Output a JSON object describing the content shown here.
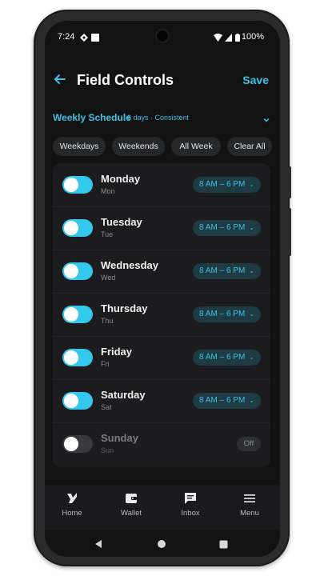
{
  "status_bar": {
    "time": "7:24",
    "battery": "100%"
  },
  "app_bar": {
    "title": "Field Controls",
    "save_label": "Save",
    "back_icon": "arrow-left-icon"
  },
  "schedule": {
    "label": "Weekly Schedule",
    "summary": "6 days · Consistent"
  },
  "chips": [
    "Weekdays",
    "Weekends",
    "All Week",
    "Clear All"
  ],
  "days": [
    {
      "name": "Monday",
      "short": "Mon",
      "enabled": true,
      "hours": "8 AM – 6 PM"
    },
    {
      "name": "Tuesday",
      "short": "Tue",
      "enabled": true,
      "hours": "8 AM – 6 PM"
    },
    {
      "name": "Wednesday",
      "short": "Wed",
      "enabled": true,
      "hours": "8 AM – 6 PM"
    },
    {
      "name": "Thursday",
      "short": "Thu",
      "enabled": true,
      "hours": "8 AM – 6 PM"
    },
    {
      "name": "Friday",
      "short": "Fri",
      "enabled": true,
      "hours": "8 AM – 6 PM"
    },
    {
      "name": "Saturday",
      "short": "Sat",
      "enabled": true,
      "hours": "8 AM – 6 PM"
    },
    {
      "name": "Sunday",
      "short": "Sun",
      "enabled": false,
      "hours": "Off"
    }
  ],
  "bottom_nav": [
    {
      "label": "Home",
      "icon": "home-icon"
    },
    {
      "label": "Wallet",
      "icon": "wallet-icon"
    },
    {
      "label": "Inbox",
      "icon": "inbox-icon"
    },
    {
      "label": "Menu",
      "icon": "menu-icon"
    }
  ],
  "colors": {
    "accent": "#3fc2e6",
    "toggle_on": "#33c8ec",
    "background": "#121213",
    "card": "#1c1c1e"
  }
}
